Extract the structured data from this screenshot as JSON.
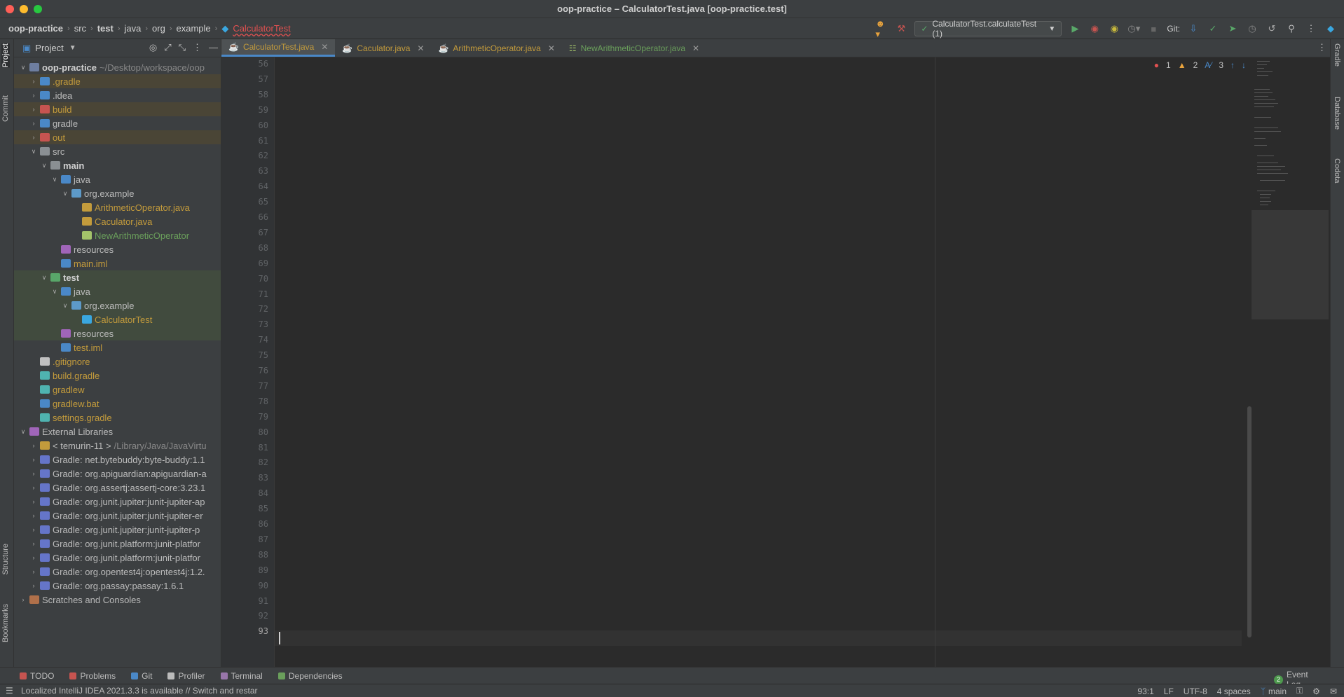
{
  "window": {
    "title": "oop-practice – CalculatorTest.java [oop-practice.test]"
  },
  "breadcrumbs": [
    "oop-practice",
    "src",
    "test",
    "java",
    "org",
    "example",
    "CalculatorTest"
  ],
  "toolbar": {
    "run_config": "CalculatorTest.calculateTest (1)",
    "git_label": "Git:"
  },
  "left_strip": {
    "project": "Project",
    "commit": "Commit",
    "structure": "Structure",
    "bookmarks": "Bookmarks"
  },
  "right_strip": {
    "gradle": "Gradle",
    "database": "Database",
    "codota": "Codota"
  },
  "project_panel": {
    "title": "Project",
    "tree": [
      {
        "label": "oop-practice",
        "extra": "~/Desktop/workspace/oop",
        "indent": 0,
        "arrow": "down",
        "style": "bold",
        "icon": "folder-module",
        "bg": ""
      },
      {
        "label": ".gradle",
        "extra": "",
        "indent": 1,
        "arrow": "right",
        "style": "orange",
        "icon": "folder-blue",
        "bg": "excl"
      },
      {
        "label": ".idea",
        "extra": "",
        "indent": 1,
        "arrow": "right",
        "style": "",
        "icon": "folder-blue",
        "bg": ""
      },
      {
        "label": "build",
        "extra": "",
        "indent": 1,
        "arrow": "right",
        "style": "orange",
        "icon": "folder-red",
        "bg": "excl"
      },
      {
        "label": "gradle",
        "extra": "",
        "indent": 1,
        "arrow": "right",
        "style": "",
        "icon": "folder-blue",
        "bg": ""
      },
      {
        "label": "out",
        "extra": "",
        "indent": 1,
        "arrow": "right",
        "style": "orange",
        "icon": "folder-red",
        "bg": "excl"
      },
      {
        "label": "src",
        "extra": "",
        "indent": 1,
        "arrow": "down",
        "style": "",
        "icon": "folder-plain",
        "bg": ""
      },
      {
        "label": "main",
        "extra": "",
        "indent": 2,
        "arrow": "down",
        "style": "bold",
        "icon": "folder-plain",
        "bg": ""
      },
      {
        "label": "java",
        "extra": "",
        "indent": 3,
        "arrow": "down",
        "style": "",
        "icon": "folder-src",
        "bg": ""
      },
      {
        "label": "org.example",
        "extra": "",
        "indent": 4,
        "arrow": "down",
        "style": "",
        "icon": "package",
        "bg": ""
      },
      {
        "label": "ArithmeticOperator.java",
        "extra": "",
        "indent": 5,
        "arrow": "",
        "style": "orange",
        "icon": "java-file",
        "bg": ""
      },
      {
        "label": "Caculator.java",
        "extra": "",
        "indent": 5,
        "arrow": "",
        "style": "orange",
        "icon": "java-file",
        "bg": ""
      },
      {
        "label": "NewArithmeticOperator",
        "extra": "",
        "indent": 5,
        "arrow": "",
        "style": "green",
        "icon": "enum",
        "bg": ""
      },
      {
        "label": "resources",
        "extra": "",
        "indent": 3,
        "arrow": "",
        "style": "",
        "icon": "folder-res",
        "bg": ""
      },
      {
        "label": "main.iml",
        "extra": "",
        "indent": 3,
        "arrow": "",
        "style": "orange",
        "icon": "iml",
        "bg": ""
      },
      {
        "label": "test",
        "extra": "",
        "indent": 2,
        "arrow": "down",
        "style": "bold",
        "icon": "folder-test",
        "bg": "test"
      },
      {
        "label": "java",
        "extra": "",
        "indent": 3,
        "arrow": "down",
        "style": "",
        "icon": "folder-src",
        "bg": "test"
      },
      {
        "label": "org.example",
        "extra": "",
        "indent": 4,
        "arrow": "down",
        "style": "",
        "icon": "package",
        "bg": "test"
      },
      {
        "label": "CalculatorTest",
        "extra": "",
        "indent": 5,
        "arrow": "",
        "style": "orange",
        "icon": "class",
        "bg": "test"
      },
      {
        "label": "resources",
        "extra": "",
        "indent": 3,
        "arrow": "",
        "style": "",
        "icon": "folder-res",
        "bg": "test"
      },
      {
        "label": "test.iml",
        "extra": "",
        "indent": 3,
        "arrow": "",
        "style": "orange",
        "icon": "iml",
        "bg": ""
      },
      {
        "label": ".gitignore",
        "extra": "",
        "indent": 1,
        "arrow": "",
        "style": "orange",
        "icon": "git",
        "bg": ""
      },
      {
        "label": "build.gradle",
        "extra": "",
        "indent": 1,
        "arrow": "",
        "style": "orange",
        "icon": "gradle",
        "bg": ""
      },
      {
        "label": "gradlew",
        "extra": "",
        "indent": 1,
        "arrow": "",
        "style": "orange",
        "icon": "gradle",
        "bg": ""
      },
      {
        "label": "gradlew.bat",
        "extra": "",
        "indent": 1,
        "arrow": "",
        "style": "orange",
        "icon": "windows",
        "bg": ""
      },
      {
        "label": "settings.gradle",
        "extra": "",
        "indent": 1,
        "arrow": "",
        "style": "orange",
        "icon": "gradle",
        "bg": ""
      },
      {
        "label": "External Libraries",
        "extra": "",
        "indent": 0,
        "arrow": "down",
        "style": "",
        "icon": "library",
        "bg": ""
      },
      {
        "label": "< temurin-11 >",
        "extra": "/Library/Java/JavaVirtu",
        "indent": 1,
        "arrow": "right",
        "style": "",
        "icon": "jdk",
        "bg": ""
      },
      {
        "label": "Gradle: net.bytebuddy:byte-buddy:1.1",
        "extra": "",
        "indent": 1,
        "arrow": "right",
        "style": "",
        "icon": "lib",
        "bg": ""
      },
      {
        "label": "Gradle: org.apiguardian:apiguardian-a",
        "extra": "",
        "indent": 1,
        "arrow": "right",
        "style": "",
        "icon": "lib",
        "bg": ""
      },
      {
        "label": "Gradle: org.assertj:assertj-core:3.23.1",
        "extra": "",
        "indent": 1,
        "arrow": "right",
        "style": "",
        "icon": "lib",
        "bg": ""
      },
      {
        "label": "Gradle: org.junit.jupiter:junit-jupiter-ap",
        "extra": "",
        "indent": 1,
        "arrow": "right",
        "style": "",
        "icon": "lib",
        "bg": ""
      },
      {
        "label": "Gradle: org.junit.jupiter:junit-jupiter-er",
        "extra": "",
        "indent": 1,
        "arrow": "right",
        "style": "",
        "icon": "lib",
        "bg": ""
      },
      {
        "label": "Gradle: org.junit.jupiter:junit-jupiter-p",
        "extra": "",
        "indent": 1,
        "arrow": "right",
        "style": "",
        "icon": "lib",
        "bg": ""
      },
      {
        "label": "Gradle: org.junit.platform:junit-platfor",
        "extra": "",
        "indent": 1,
        "arrow": "right",
        "style": "",
        "icon": "lib",
        "bg": ""
      },
      {
        "label": "Gradle: org.junit.platform:junit-platfor",
        "extra": "",
        "indent": 1,
        "arrow": "right",
        "style": "",
        "icon": "lib",
        "bg": ""
      },
      {
        "label": "Gradle: org.opentest4j:opentest4j:1.2.",
        "extra": "",
        "indent": 1,
        "arrow": "right",
        "style": "",
        "icon": "lib",
        "bg": ""
      },
      {
        "label": "Gradle: org.passay:passay:1.6.1",
        "extra": "",
        "indent": 1,
        "arrow": "right",
        "style": "",
        "icon": "lib",
        "bg": ""
      },
      {
        "label": "Scratches and Consoles",
        "extra": "",
        "indent": 0,
        "arrow": "right",
        "style": "",
        "icon": "scratch",
        "bg": ""
      }
    ]
  },
  "editor_tabs": [
    {
      "label": "CalculatorTest.java",
      "active": true,
      "style": "orange"
    },
    {
      "label": "Caculator.java",
      "active": false,
      "style": "orange"
    },
    {
      "label": "ArithmeticOperator.java",
      "active": false,
      "style": "orange"
    },
    {
      "label": "NewArithmeticOperator.java",
      "active": false,
      "style": "green"
    }
  ],
  "editor": {
    "line_numbers": [
      "56",
      "57",
      "58",
      "59",
      "60",
      "61",
      "62",
      "63",
      "64",
      "65",
      "66",
      "67",
      "68",
      "69",
      "70",
      "71",
      "72",
      "73",
      "74",
      "75",
      "76",
      "77",
      "78",
      "79",
      "80",
      "81",
      "82",
      "83",
      "84",
      "85",
      "86",
      "87",
      "88",
      "89",
      "90",
      "91",
      "92",
      "93"
    ],
    "current_line": "93",
    "inspections": {
      "errors": "1",
      "warnings": "2",
      "typos": "3"
    }
  },
  "bottom_tools": [
    {
      "label": "TODO",
      "icon": "todo-icon",
      "color": "#c75450"
    },
    {
      "label": "Problems",
      "icon": "problems-icon",
      "color": "#c75450"
    },
    {
      "label": "Git",
      "icon": "git-branch-icon",
      "color": "#4a88c7"
    },
    {
      "label": "Profiler",
      "icon": "profiler-icon",
      "color": "#bbbbbb"
    },
    {
      "label": "Terminal",
      "icon": "terminal-icon",
      "color": "#9876aa"
    },
    {
      "label": "Dependencies",
      "icon": "dependencies-icon",
      "color": "#6a9f5b"
    }
  ],
  "event_log": {
    "label": "Event Log",
    "count": "2"
  },
  "status": {
    "message": "Localized IntelliJ IDEA 2021.3.3 is available // Switch and restar",
    "position": "93:1",
    "line_sep": "LF",
    "encoding": "UTF-8",
    "indent": "4 spaces",
    "branch": "main"
  },
  "colors": {
    "accent": "#4a88c7",
    "error": "#e05050",
    "warning": "#e8a33d",
    "run_green": "#59a869"
  }
}
